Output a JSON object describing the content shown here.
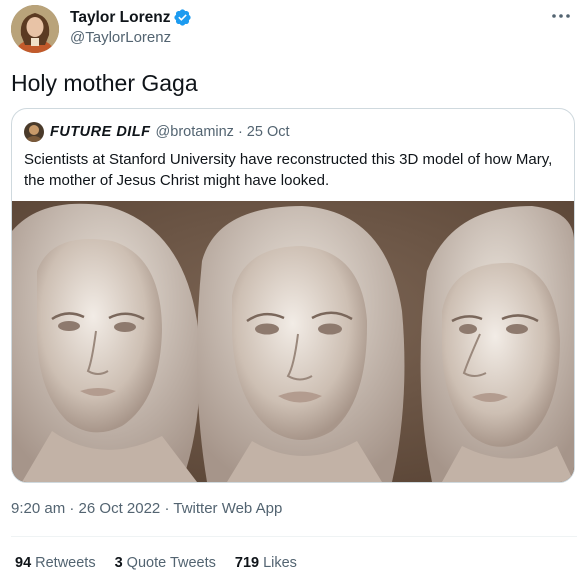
{
  "author": {
    "display_name": "Taylor Lorenz",
    "handle": "@TaylorLorenz",
    "verified": true,
    "avatar_icon": "user-avatar",
    "more_icon": "more-dots-icon"
  },
  "tweet": {
    "text": "Holy mother Gaga",
    "time": "9:20 am",
    "date": "26 Oct 2022",
    "source": "Twitter Web App",
    "separator": "·"
  },
  "quoted": {
    "display_name": "FUTURE DILF",
    "handle": "@brotaminz",
    "separator": "·",
    "date": "25 Oct",
    "text": "Scientists at Stanford University have reconstructed this 3D model of how Mary, the mother of Jesus Christ might have looked.",
    "media_alt": "three sculpted 3D head renders"
  },
  "stats": {
    "retweets": {
      "count": "94",
      "label": "Retweets"
    },
    "quotes": {
      "count": "3",
      "label": "Quote Tweets"
    },
    "likes": {
      "count": "719",
      "label": "Likes"
    }
  },
  "colors": {
    "text": "#0f1419",
    "secondary": "#536471",
    "verified": "#1d9bf0",
    "border": "#cfd9de",
    "media_bg": "#6e5849"
  }
}
